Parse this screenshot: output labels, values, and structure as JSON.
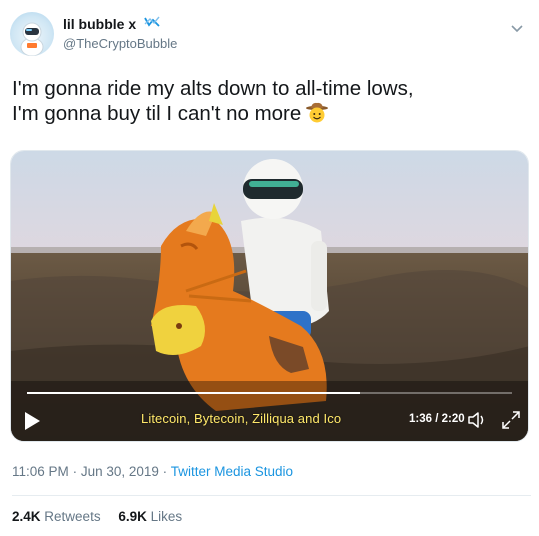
{
  "tweet": {
    "display_name": "lil bubble x",
    "handle": "@TheCryptoBubble",
    "text_lines": [
      "I'm gonna ride my alts down to all-time lows,",
      "I'm gonna buy til I can't no more"
    ],
    "emoji": "cowboy-face"
  },
  "video": {
    "caption": "Litecoin, Bytecoin, Zilliqua and Ico",
    "timecode": "1:36 / 2:20",
    "progress": 0.6857
  },
  "meta": {
    "time": "11:06 PM",
    "separator": "·",
    "date": "Jun 30, 2019",
    "source": "Twitter Media Studio"
  },
  "stats": {
    "retweets_count": "2.4K",
    "retweets_label": "Retweets",
    "likes_count": "6.9K",
    "likes_label": "Likes"
  },
  "icons": {
    "avatar": "astronaut-avatar",
    "name_badge": "chart-icon",
    "menu": "chevron-down-icon",
    "play": "play-icon",
    "volume": "volume-icon",
    "fullscreen": "fullscreen-icon"
  },
  "colors": {
    "link": "#1b95e0",
    "muted": "#657786",
    "text": "#14171a",
    "caption": "#ffe86a"
  }
}
